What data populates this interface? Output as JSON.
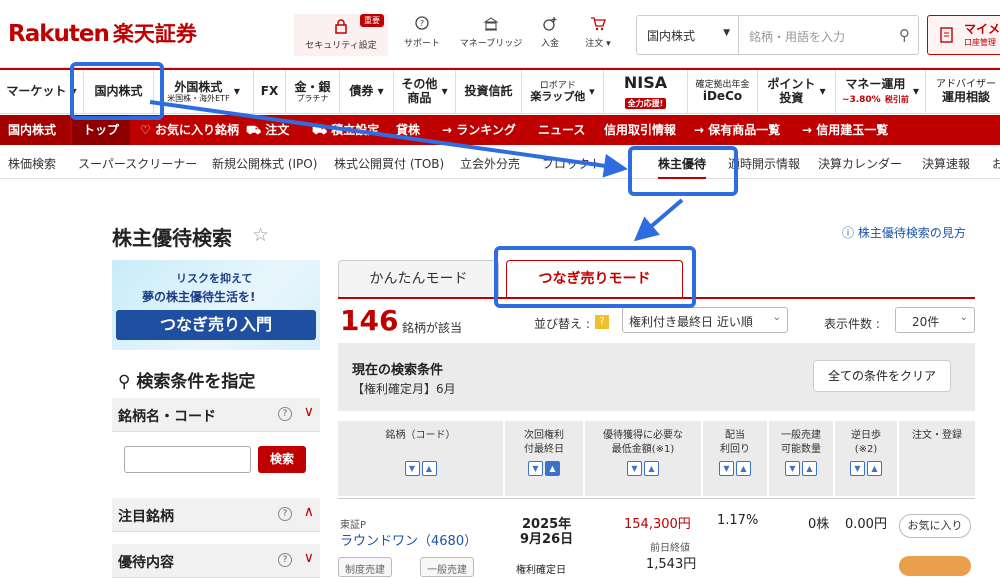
{
  "header": {
    "logo_en": "Rakuten",
    "logo_jp": "楽天証券",
    "tools": [
      {
        "label": "セキュリティ設定",
        "badge": "重要"
      },
      {
        "label": "サポート"
      },
      {
        "label": "マネーブリッジ"
      },
      {
        "label": "入金"
      },
      {
        "label": "注文 ▾"
      }
    ],
    "search": {
      "category": "国内株式",
      "placeholder": "銘柄・用語を入力"
    },
    "mypage": {
      "label": "マイメ",
      "sub": "口座管理"
    }
  },
  "nav_main": [
    {
      "label": "マーケット"
    },
    {
      "label": "国内株式"
    },
    {
      "label": "外国株式",
      "sub": "米国株・海外ETF"
    },
    {
      "label": "FX"
    },
    {
      "label": "金・銀",
      "sub": "プラチナ"
    },
    {
      "label": "債券"
    },
    {
      "label": "その他",
      "label2": "商品"
    },
    {
      "label": "投資信託"
    },
    {
      "label": "ロボアド",
      "label2": "楽ラップ他"
    },
    {
      "label": "NISA",
      "badge": "全力応援!"
    },
    {
      "label": "確定拠出年金",
      "label2": "iDeCo"
    },
    {
      "label": "ポイント",
      "label2": "投資"
    },
    {
      "label": "マネー運用",
      "sub_red": "~3.80%",
      "sub": "税引前"
    },
    {
      "label": "アドバイザー",
      "label2": "運用相談"
    }
  ],
  "nav_sub": [
    "国内株式",
    "トップ",
    "お気に入り銘柄",
    "注文",
    "積立設定",
    "貸株",
    "ランキング",
    "ニュース",
    "信用取引情報",
    "保有商品一覧",
    "信用建玉一覧"
  ],
  "nav_third": [
    "株価検索",
    "スーパースクリーナー",
    "新規公開株式 (IPO)",
    "株式公開買付 (TOB)",
    "立会外分売",
    "ブロックト",
    "株主優待",
    "適時開示情報",
    "決算カレンダー",
    "決算速報",
    "お"
  ],
  "page": {
    "title": "株主優待検索",
    "howto": "株主優待検索の見方",
    "banner": {
      "line1": "リスクを抑えて",
      "line2": "夢の株主優待生活を!",
      "line3": "つなぎ売り入門"
    },
    "side_heading": "検索条件を指定",
    "panels": [
      {
        "title": "銘柄名・コード"
      },
      {
        "title": "注目銘柄"
      },
      {
        "title": "優待内容"
      }
    ],
    "search_button": "検索",
    "tabs": [
      "かんたんモード",
      "つなぎ売りモード"
    ],
    "result_count": "146",
    "result_label": "銘柄が該当",
    "sort_label": "並び替え :",
    "sort_help": "?",
    "sort_value": "権利付き最終日 近い順",
    "per_page_label": "表示件数 :",
    "per_page_value": "20件",
    "cond_title": "現在の検索条件",
    "cond_value": "【権利確定月】6月",
    "clear_button": "全ての条件をクリア"
  },
  "table": {
    "headers": [
      {
        "l1": "銘柄（コード）"
      },
      {
        "l1": "次回権利",
        "l2": "付最終日"
      },
      {
        "l1": "優待獲得に必要な",
        "l2": "最低金額(※1)"
      },
      {
        "l1": "配当",
        "l2": "利回り"
      },
      {
        "l1": "一般売建",
        "l2": "可能数量"
      },
      {
        "l1": "逆日歩",
        "l2": "(※2)"
      },
      {
        "l1": "注文・登録"
      }
    ],
    "row": {
      "market": "東証P",
      "name": "ラウンドワン（4680）",
      "date_l1": "2025年",
      "date_l2": "9月26日",
      "date_l3": "権利確定日",
      "min_amount": "154,300円",
      "prev_label": "前日終値",
      "prev_value": "1,543円",
      "yield": "1.17%",
      "qty": "0株",
      "reverse": "0.00円",
      "fav": "お気に入り",
      "pill1": "制度売建",
      "pill2": "一般売建"
    }
  }
}
